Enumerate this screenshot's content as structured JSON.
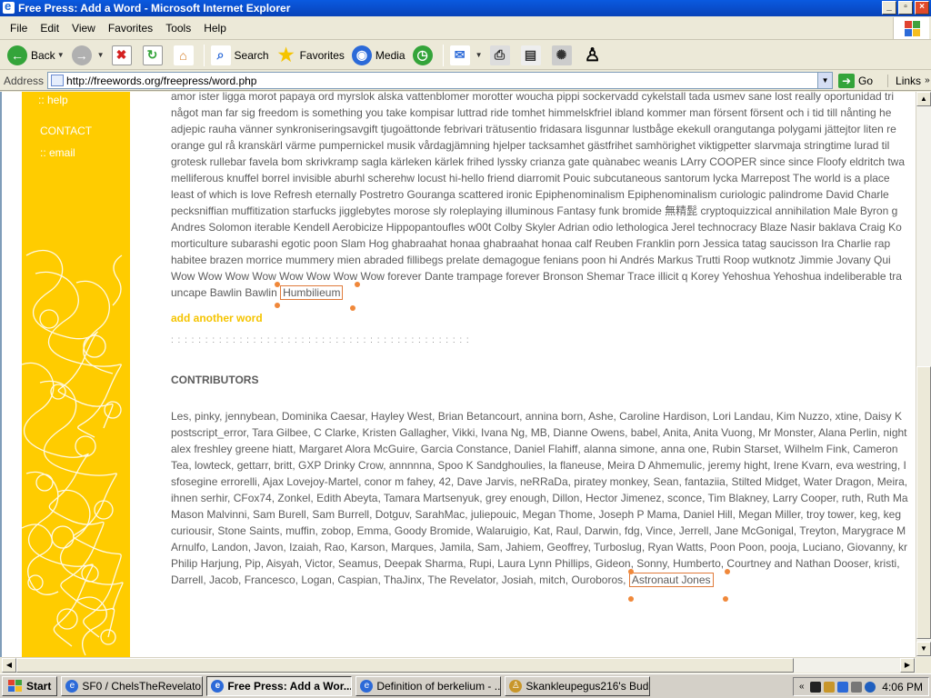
{
  "window": {
    "title": "Free Press: Add a Word - Microsoft Internet Explorer",
    "buttons": [
      "_",
      "▫",
      "×"
    ]
  },
  "menu": [
    "File",
    "Edit",
    "View",
    "Favorites",
    "Tools",
    "Help"
  ],
  "toolbar": {
    "back": "Back",
    "search": "Search",
    "favorites": "Favorites",
    "media": "Media"
  },
  "address": {
    "label": "Address",
    "url": "http://freewords.org/freepress/word.php",
    "go": "Go",
    "links": "Links"
  },
  "sidebar": {
    "help": ":: help",
    "contact_head": "CONTACT",
    "email": ":: email"
  },
  "words": {
    "lines": [
      "amor ister ligga morot papaya ord myrslok alska vattenblomer morotter woucha pippi sockervadd cykelstall tada usmev sane lost really oportunidad tri",
      "något man far sig freedom is something you take kompisar luttrad ride tomhet himmelskfriel ibland kommer man försent försent och i tid till nånting he",
      "adjepic rauha vänner synkroniseringsavgift tjugoättonde febrivari trätusentio fridasara lisgunnar lustbåge ekekull orangutanga polygami jättejtor liten re",
      "orange gul rå kranskärl värme pumpernickel musik vårdagjämning hjelper tacksamhet gästfrihet samhörighet viktigpetter slarvmaja stringtime lurad til",
      "grotesk rullebar favela bom skrivkramp sagla kärleken kärlek frihed lyssky crianza gate quànabec weanis LArry COOPER since since Floofy eldritch twa",
      "melliferous knuffel borrel invisible aburhl scherehw locust hi-hello friend diarromit Pouic subcutaneous santorum lycka Marrepost The world is a place",
      "least of which is love Refresh eternally Postretro Gouranga scattered ironic Epiphenominalism Epiphenominalism curiologic palindrome David Charle",
      "pecksniffian muffitization starfucks jigglebytes morose sly roleplaying illuminous Fantasy funk bromide 無精髭 cryptoquizzical annihilation Male Byron g",
      "Andres Solomon iterable Kendell Aerobicize Hippopantoufles w00t Colby Skyler Adrian odio lethologica Jerel technocracy Blaze Nasir baklava Craig Ko",
      "morticulture subarashi egotic poon Slam Hog ghabraahat honaa ghabraahat honaa calf Reuben Franklin porn Jessica tatag saucisson Ira Charlie rap",
      "habitee brazen morrice mummery mien abraded fillibegs prelate demagogue fenians poon hi Andrés Markus Trutti Roop wutknotz Jimmie Jovany Qui",
      "Wow Wow Wow Wow Wow Wow Wow Wow forever Dante trampage forever Bronson Shemar Trace illicit q Korey Yehoshua Yehoshua indeliberable tra"
    ],
    "last_line_prefix": "uncape Bawlin Bawlin",
    "new_word": "Humbilieum",
    "add_another": "add another word",
    "dots": ":  :  :  :  :  :  :  :  :  :  :  :  :  :  :  :  :  :  :  :  :  :  :  :  :  :  :  :  :  :  :  :  :  :  :  :  :  :  :  :  :  :  :  :"
  },
  "contributors": {
    "heading": "CONTRIBUTORS",
    "lines": [
      "Les, pinky, jennybean, Dominika Caesar, Hayley West, Brian Betancourt, annina born, Ashe, Caroline Hardison, Lori Landau, Kim Nuzzo, xtine, Daisy K",
      "postscript_error, Tara Gilbee, C Clarke, Kristen Gallagher, Vikki, Ivana Ng, MB, Dianne Owens, babel, Anita, Anita Vuong, Mr Monster, Alana Perlin, night",
      "alex freshley greene hiatt, Margaret Alora McGuire, Garcia Constance, Daniel Flahiff, alanna simone, anna one, Rubin Starset, Wilhelm Fink, Cameron",
      "Tea, lowteck, gettarr, britt, GXP Drinky Crow, annnnna, Spoo K Sandghoulies, la flaneuse, Meira D Ahmemulic, jeremy hight, Irene Kvarn, eva westring, I",
      "sfosegine errorelli, Ajax Lovejoy-Martel, conor m fahey, 42, Dave Jarvis, neRRaDa, piratey monkey, Sean, fantaziia, Stilted Midget, Water Dragon, Meira,",
      "ihnen serhir, CFox74, Zonkel, Edith Abeyta, Tamara Martsenyuk, grey enough, Dillon, Hector Jimenez, sconce, Tim Blakney, Larry Cooper, ruth, Ruth Ma",
      "Mason Malvinni, Sam Burell, Sam Burrell, Dotguv, SarahMac, juliepouic, Megan Thome, Joseph P Mama, Daniel Hill, Megan Miller, troy tower, keg, keg",
      "curiousir, Stone Saints, muffin, zobop, Emma, Goody Bromide, Walaruigio, Kat, Raul, Darwin, fdg, Vince, Jerrell, Jane McGonigal, Treyton, Marygrace M",
      "Arnulfo, Landon, Javon, Izaiah, Rao, Karson, Marques, Jamila, Sam, Jahiem, Geoffrey, Turboslug, Ryan Watts, Poon Poon, pooja, Luciano, Giovanny, kr",
      "Philip Harjung, Pip, Aisyah, Victor, Seamus, Deepak Sharma, Rupi, Laura Lynn Phillips, Gideon, Sonny, Humberto, Courtney and Nathan Dooser, kristi,"
    ],
    "last_line_prefix": "Darrell, Jacob, Francesco, Logan, Caspian, ThaJinx, The Revelator, Josiah, mitch, Ouroboros,",
    "new_contributor": "Astronaut Jones"
  },
  "taskbar": {
    "start": "Start",
    "items": [
      "SF0 / ChelsTheRevelator...",
      "Free Press: Add a Wor...",
      "Definition of berkelium - ...",
      "Skankleupegus216's Bud..."
    ],
    "active_index": 1,
    "clock": "4:06 PM"
  },
  "colors": {
    "accent_yellow": "#ffcc00",
    "highlight_orange": "#e07a3a",
    "link_yellow": "#f5c400"
  }
}
